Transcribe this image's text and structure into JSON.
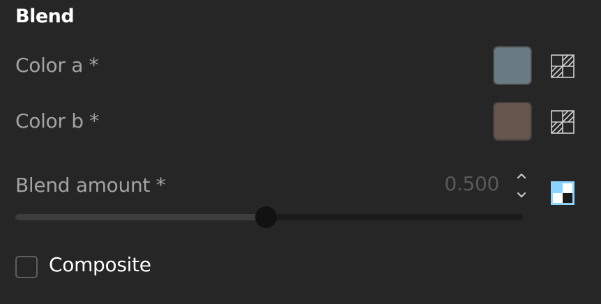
{
  "panel": {
    "title": "Blend"
  },
  "color_a": {
    "label": "Color a *",
    "value": "#6b7b86",
    "icon": "connect-input-icon"
  },
  "color_b": {
    "label": "Color b *",
    "value": "#65554d",
    "icon": "connect-input-icon"
  },
  "blend_amount": {
    "label": "Blend amount *",
    "value": "0.500",
    "fraction": 0.5,
    "increment_icon": "chevron-up-icon",
    "decrement_icon": "chevron-down-icon",
    "link_icon": "connected-input-icon",
    "link_color": "#8ad4ff"
  },
  "composite": {
    "label": "Composite",
    "checked": false
  },
  "colors": {
    "background": "#262626",
    "text_primary": "#ffffff",
    "text_secondary": "#a3a3a3"
  }
}
